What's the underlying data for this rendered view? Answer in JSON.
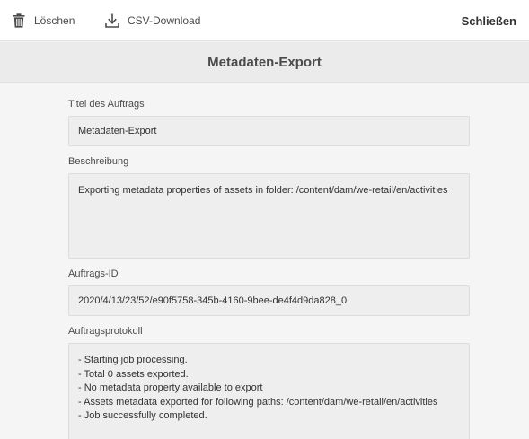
{
  "toolbar": {
    "delete_label": "Löschen",
    "csv_download_label": "CSV-Download",
    "close_label": "Schließen"
  },
  "page": {
    "title": "Metadaten-Export"
  },
  "form": {
    "job_title": {
      "label": "Titel des Auftrags",
      "value": "Metadaten-Export"
    },
    "description": {
      "label": "Beschreibung",
      "value": "Exporting metadata properties of assets in folder: /content/dam/we-retail/en/activities"
    },
    "job_id": {
      "label": "Auftrags-ID",
      "value": "2020/4/13/23/52/e90f5758-345b-4160-9bee-de4f4d9da828_0"
    },
    "job_log": {
      "label": "Auftragsprotokoll",
      "lines": [
        "- Starting job processing.",
        "- Total 0 assets exported.",
        "- No metadata property available to export",
        "- Assets metadata exported for following paths: /content/dam/we-retail/en/activities",
        "- Job successfully completed."
      ]
    }
  },
  "icons": {
    "delete": "trash-icon",
    "csv_download": "download-icon"
  }
}
